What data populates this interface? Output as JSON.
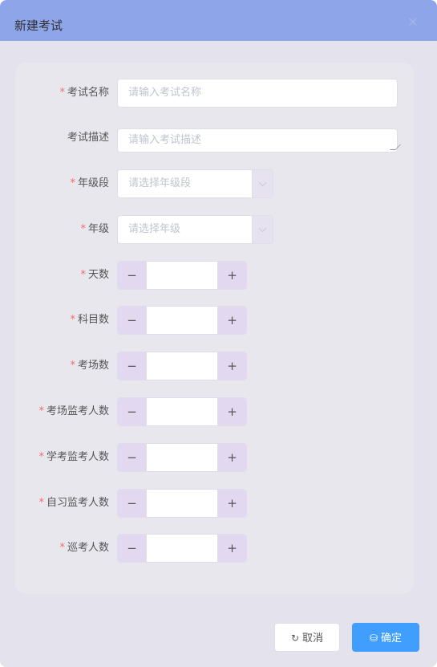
{
  "dialog": {
    "title": "新建考试",
    "close_icon": "close-icon"
  },
  "form": {
    "exam_name": {
      "label": "考试名称",
      "required": true,
      "placeholder": "请输入考试名称",
      "value": ""
    },
    "exam_desc": {
      "label": "考试描述",
      "required": false,
      "placeholder": "请输入考试描述",
      "value": ""
    },
    "grade_segment": {
      "label": "年级段",
      "required": true,
      "placeholder": "请选择年级段",
      "arrow_icon": "chevron-down-icon"
    },
    "grade": {
      "label": "年级",
      "required": true,
      "placeholder": "请选择年级",
      "arrow_icon": "chevron-down-icon"
    },
    "steppers": [
      {
        "key": "days",
        "label": "天数",
        "required": true,
        "value": "",
        "minus": "−",
        "plus": "+"
      },
      {
        "key": "subjects",
        "label": "科目数",
        "required": true,
        "value": "",
        "minus": "−",
        "plus": "+"
      },
      {
        "key": "rooms",
        "label": "考场数",
        "required": true,
        "value": "",
        "minus": "−",
        "plus": "+"
      },
      {
        "key": "room_proctors",
        "label": "考场监考人数",
        "required": true,
        "value": "",
        "minus": "−",
        "plus": "+"
      },
      {
        "key": "student_proctors",
        "label": "学考监考人数",
        "required": true,
        "value": "",
        "minus": "−",
        "plus": "+"
      },
      {
        "key": "study_proctors",
        "label": "自习监考人数",
        "required": true,
        "value": "",
        "minus": "−",
        "plus": "+"
      },
      {
        "key": "patrol",
        "label": "巡考人数",
        "required": true,
        "value": "",
        "minus": "−",
        "plus": "+"
      }
    ]
  },
  "required_mark": "*",
  "footer": {
    "cancel_label": "取消",
    "cancel_icon": "refresh-icon",
    "ok_label": "确定",
    "ok_icon": "database-icon"
  },
  "colors": {
    "header": "#8ea5ea",
    "primary": "#409eff",
    "required": "#f56c6c",
    "stepper_button": "#e2d9f0"
  }
}
